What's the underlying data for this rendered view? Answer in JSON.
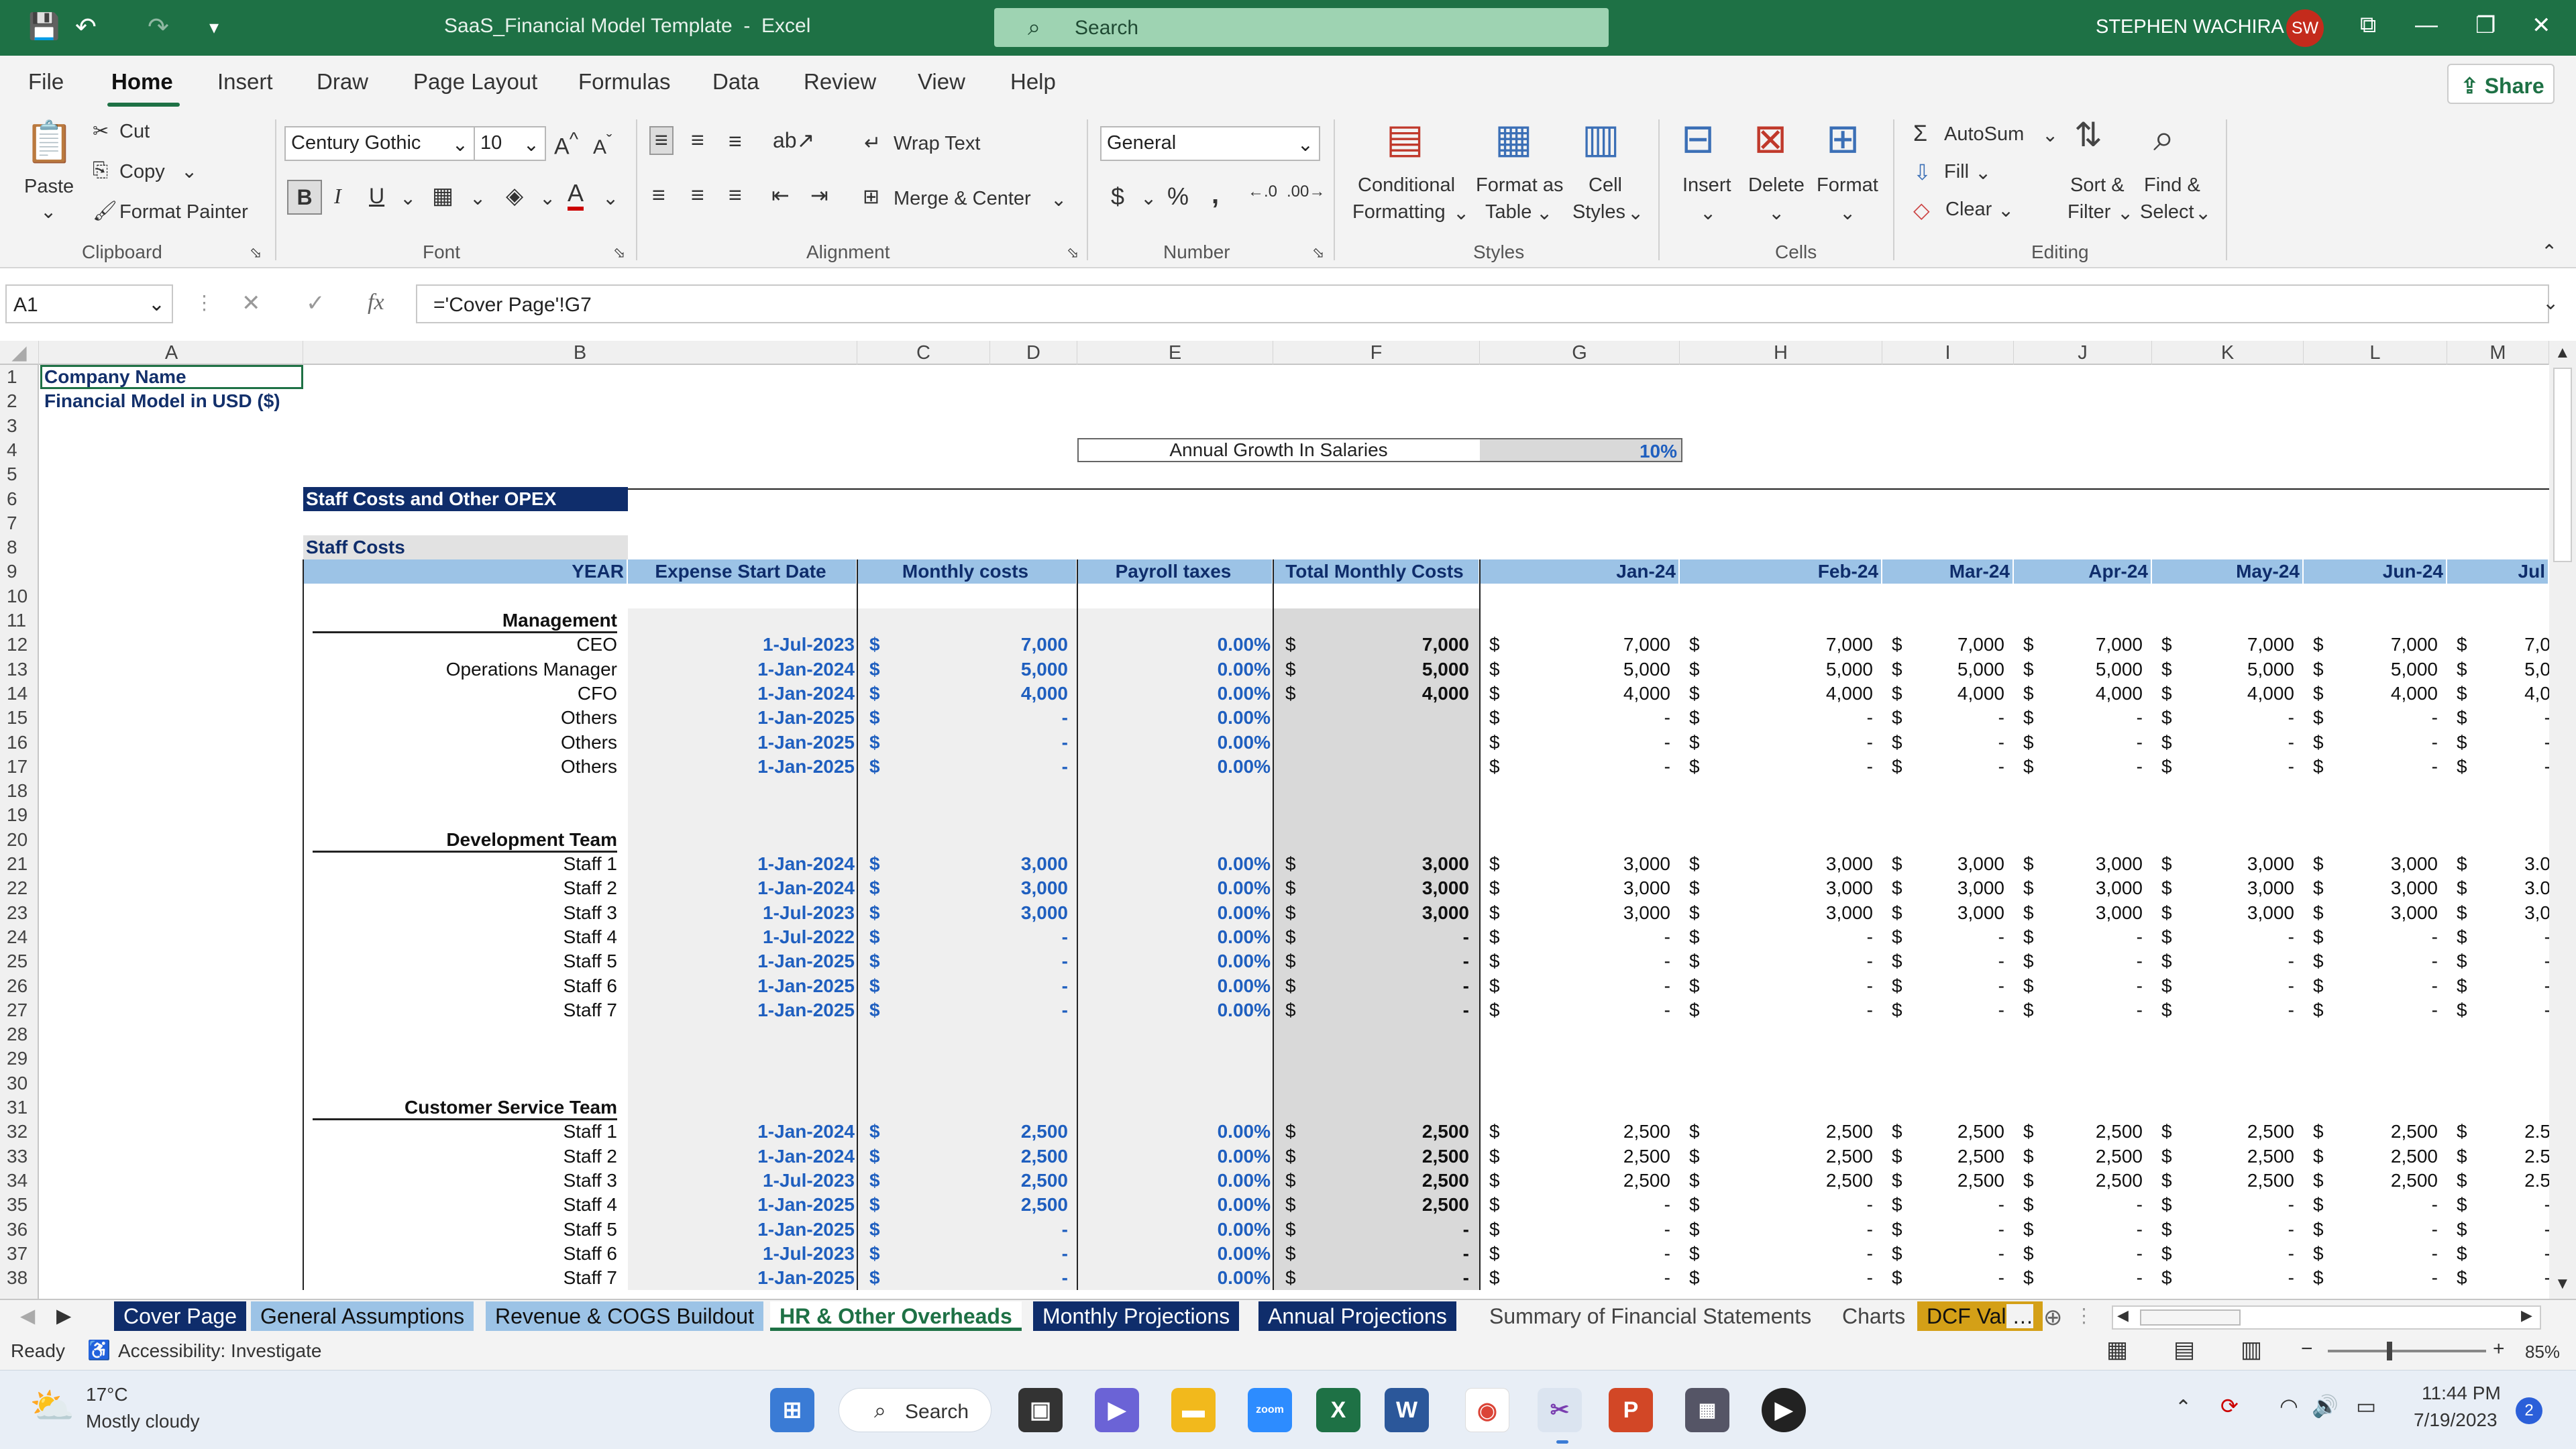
{
  "title_bar": {
    "doc_title": "SaaS_Financial Model Template",
    "separator": "-",
    "app": "Excel",
    "search_placeholder": "Search",
    "user": "STEPHEN WACHIRA",
    "initials": "SW"
  },
  "menu": [
    "File",
    "Home",
    "Insert",
    "Draw",
    "Page Layout",
    "Formulas",
    "Data",
    "Review",
    "View",
    "Help"
  ],
  "share_label": "Share",
  "ribbon": {
    "clipboard": {
      "paste": "Paste",
      "cut": "Cut",
      "copy": "Copy",
      "format_painter": "Format Painter",
      "group": "Clipboard"
    },
    "font": {
      "name": "Century Gothic",
      "size": "10",
      "group": "Font"
    },
    "alignment": {
      "wrap": "Wrap Text",
      "merge": "Merge & Center",
      "group": "Alignment"
    },
    "number": {
      "format": "General",
      "group": "Number"
    },
    "styles": {
      "cond1": "Conditional",
      "cond2": "Formatting",
      "fmt1": "Format as",
      "fmt2": "Table",
      "cell1": "Cell",
      "cell2": "Styles",
      "group": "Styles"
    },
    "cells": {
      "insert": "Insert",
      "delete": "Delete",
      "format": "Format",
      "group": "Cells"
    },
    "editing": {
      "autosum": "AutoSum",
      "fill": "Fill",
      "clear": "Clear",
      "sort1": "Sort &",
      "sort2": "Filter",
      "find1": "Find &",
      "find2": "Select",
      "group": "Editing"
    }
  },
  "formula_bar": {
    "name_box": "A1",
    "fx": "fx",
    "formula": "='Cover Page'!G7"
  },
  "columns": [
    "A",
    "B",
    "C",
    "D",
    "E",
    "F",
    "G",
    "H",
    "I",
    "J",
    "K",
    "L",
    "M"
  ],
  "rows": [
    "1",
    "2",
    "3",
    "4",
    "5",
    "6",
    "7",
    "8",
    "9",
    "10",
    "11",
    "12",
    "13",
    "14",
    "15",
    "16",
    "17",
    "18",
    "19",
    "20",
    "21",
    "22",
    "23",
    "24",
    "25",
    "26",
    "27",
    "28",
    "29",
    "30",
    "31",
    "32",
    "33",
    "34",
    "35",
    "36",
    "37",
    "38"
  ],
  "sheet": {
    "company": "Company Name",
    "subtitle": "Financial  Model in USD ($)",
    "growth_label": "Annual Growth In Salaries",
    "growth_value": "10%",
    "section_title": "Staff Costs and Other OPEX",
    "staff_costs": "Staff Costs",
    "headers": {
      "year": "YEAR",
      "start": "Expense Start Date",
      "monthly": "Monthly costs",
      "payroll": "Payroll taxes",
      "total": "Total Monthly Costs"
    },
    "months": [
      "Jan-24",
      "Feb-24",
      "Mar-24",
      "Apr-24",
      "May-24",
      "Jun-24",
      "Jul"
    ],
    "currency": "$",
    "groups": [
      {
        "title": "Management",
        "rows": [
          {
            "name": "CEO",
            "start": "1-Jul-2023",
            "monthly": "7,000",
            "tax": "0.00%",
            "total": "7,000",
            "m": [
              "7,000",
              "7,000",
              "7,000",
              "7,000",
              "7,000",
              "7,000",
              "7,0"
            ]
          },
          {
            "name": "Operations  Manager",
            "start": "1-Jan-2024",
            "monthly": "5,000",
            "tax": "0.00%",
            "total": "5,000",
            "m": [
              "5,000",
              "5,000",
              "5,000",
              "5,000",
              "5,000",
              "5,000",
              "5,0"
            ]
          },
          {
            "name": "CFO",
            "start": "1-Jan-2024",
            "monthly": "4,000",
            "tax": "0.00%",
            "total": "4,000",
            "m": [
              "4,000",
              "4,000",
              "4,000",
              "4,000",
              "4,000",
              "4,000",
              "4,0"
            ]
          },
          {
            "name": "Others",
            "start": "1-Jan-2025",
            "monthly": "-",
            "tax": "0.00%",
            "total": "",
            "m": [
              "-",
              "-",
              "-",
              "-",
              "-",
              "-",
              "-"
            ]
          },
          {
            "name": "Others",
            "start": "1-Jan-2025",
            "monthly": "-",
            "tax": "0.00%",
            "total": "",
            "m": [
              "-",
              "-",
              "-",
              "-",
              "-",
              "-",
              "-"
            ]
          },
          {
            "name": "Others",
            "start": "1-Jan-2025",
            "monthly": "-",
            "tax": "0.00%",
            "total": "",
            "m": [
              "-",
              "-",
              "-",
              "-",
              "-",
              "-",
              "-"
            ]
          }
        ]
      },
      {
        "title": "Development Team",
        "rows": [
          {
            "name": "Staff 1",
            "start": "1-Jan-2024",
            "monthly": "3,000",
            "tax": "0.00%",
            "total": "3,000",
            "m": [
              "3,000",
              "3,000",
              "3,000",
              "3,000",
              "3,000",
              "3,000",
              "3.0"
            ]
          },
          {
            "name": "Staff 2",
            "start": "1-Jan-2024",
            "monthly": "3,000",
            "tax": "0.00%",
            "total": "3,000",
            "m": [
              "3,000",
              "3,000",
              "3,000",
              "3,000",
              "3,000",
              "3,000",
              "3.0"
            ]
          },
          {
            "name": "Staff 3",
            "start": "1-Jul-2023",
            "monthly": "3,000",
            "tax": "0.00%",
            "total": "3,000",
            "m": [
              "3,000",
              "3,000",
              "3,000",
              "3,000",
              "3,000",
              "3,000",
              "3,0"
            ]
          },
          {
            "name": "Staff 4",
            "start": "1-Jul-2022",
            "monthly": "-",
            "tax": "0.00%",
            "total": "-",
            "m": [
              "-",
              "-",
              "-",
              "-",
              "-",
              "-",
              "-"
            ]
          },
          {
            "name": "Staff 5",
            "start": "1-Jan-2025",
            "monthly": "-",
            "tax": "0.00%",
            "total": "-",
            "m": [
              "-",
              "-",
              "-",
              "-",
              "-",
              "-",
              "-"
            ]
          },
          {
            "name": "Staff 6",
            "start": "1-Jan-2025",
            "monthly": "-",
            "tax": "0.00%",
            "total": "-",
            "m": [
              "-",
              "-",
              "-",
              "-",
              "-",
              "-",
              "-"
            ]
          },
          {
            "name": "Staff 7",
            "start": "1-Jan-2025",
            "monthly": "-",
            "tax": "0.00%",
            "total": "-",
            "m": [
              "-",
              "-",
              "-",
              "-",
              "-",
              "-",
              "-"
            ]
          }
        ]
      },
      {
        "title": "Customer Service Team",
        "rows": [
          {
            "name": "Staff 1",
            "start": "1-Jan-2024",
            "monthly": "2,500",
            "tax": "0.00%",
            "total": "2,500",
            "m": [
              "2,500",
              "2,500",
              "2,500",
              "2,500",
              "2,500",
              "2,500",
              "2.5"
            ]
          },
          {
            "name": "Staff 2",
            "start": "1-Jan-2024",
            "monthly": "2,500",
            "tax": "0.00%",
            "total": "2,500",
            "m": [
              "2,500",
              "2,500",
              "2,500",
              "2,500",
              "2,500",
              "2,500",
              "2.5"
            ]
          },
          {
            "name": "Staff 3",
            "start": "1-Jul-2023",
            "monthly": "2,500",
            "tax": "0.00%",
            "total": "2,500",
            "m": [
              "2,500",
              "2,500",
              "2,500",
              "2,500",
              "2,500",
              "2,500",
              "2.5"
            ]
          },
          {
            "name": "Staff 4",
            "start": "1-Jan-2025",
            "monthly": "2,500",
            "tax": "0.00%",
            "total": "2,500",
            "m": [
              "-",
              "-",
              "-",
              "-",
              "-",
              "-",
              "-"
            ]
          },
          {
            "name": "Staff 5",
            "start": "1-Jan-2025",
            "monthly": "-",
            "tax": "0.00%",
            "total": "-",
            "m": [
              "-",
              "-",
              "-",
              "-",
              "-",
              "-",
              "-"
            ]
          },
          {
            "name": "Staff 6",
            "start": "1-Jul-2023",
            "monthly": "-",
            "tax": "0.00%",
            "total": "-",
            "m": [
              "-",
              "-",
              "-",
              "-",
              "-",
              "-",
              "-"
            ]
          },
          {
            "name": "Staff 7",
            "start": "1-Jan-2025",
            "monthly": "-",
            "tax": "0.00%",
            "total": "-",
            "m": [
              "-",
              "-",
              "-",
              "-",
              "-",
              "-",
              "-"
            ]
          }
        ]
      }
    ]
  },
  "sheet_tabs": [
    "Cover Page",
    "General Assumptions",
    "Revenue & COGS Buildout",
    "HR & Other Overheads",
    "Monthly Projections",
    "Annual Projections",
    "Summary of Financial Statements",
    "Charts",
    "DCF Val"
  ],
  "status": {
    "ready": "Ready",
    "accessibility": "Accessibility: Investigate",
    "zoom": "85%"
  },
  "taskbar": {
    "temp": "17°C",
    "weather": "Mostly cloudy",
    "search": "Search",
    "time": "11:44 PM",
    "date": "7/19/2023",
    "badge": "2",
    "zoom_app": "zoom"
  },
  "colors": {
    "excel_green": "#1e7145",
    "navy": "#0f2d6b",
    "header_blue": "#9cc3e6",
    "input_blue": "#1f5fbf"
  }
}
